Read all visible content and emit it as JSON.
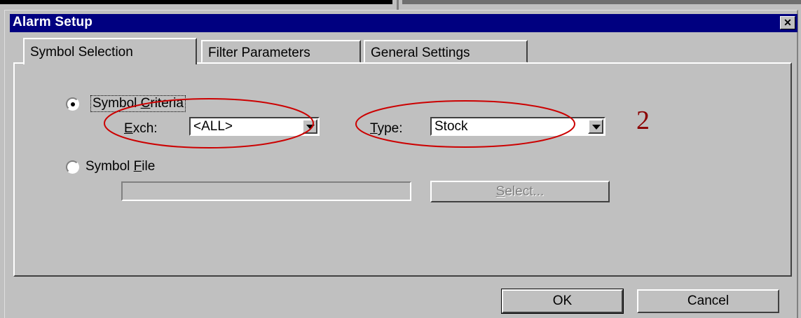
{
  "window": {
    "title": "Alarm Setup",
    "close_label": "✕"
  },
  "tabs": [
    {
      "label": "Symbol Selection",
      "active": true
    },
    {
      "label": "Filter Parameters",
      "active": false
    },
    {
      "label": "General Settings",
      "active": false
    }
  ],
  "symbol_criteria": {
    "label_prefix": "Symbol ",
    "label_accel": "C",
    "label_rest": "riteria",
    "selected": true,
    "exch": {
      "accel": "E",
      "rest": "xch:",
      "value": "<ALL>"
    },
    "type": {
      "accel": "T",
      "rest": "ype:",
      "value": "Stock"
    }
  },
  "symbol_file": {
    "label_prefix": "Symbol ",
    "label_accel": "F",
    "label_rest": "ile",
    "selected": false,
    "path_value": "",
    "select_button": {
      "accel": "S",
      "rest": "elect..."
    }
  },
  "annotation": {
    "number": "2",
    "color": "#cc0000"
  },
  "footer": {
    "ok_label": "OK",
    "cancel_label": "Cancel"
  }
}
